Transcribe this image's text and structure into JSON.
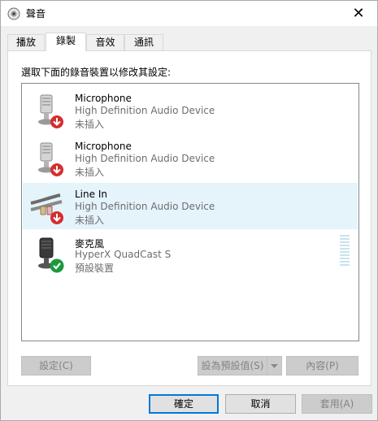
{
  "window": {
    "title": "聲音",
    "close_glyph": "✕"
  },
  "tabs": [
    {
      "label": "播放",
      "active": false
    },
    {
      "label": "錄製",
      "active": true
    },
    {
      "label": "音效",
      "active": false
    },
    {
      "label": "通訊",
      "active": false
    }
  ],
  "panel": {
    "instruction": "選取下面的錄音裝置以修改其設定:"
  },
  "devices": [
    {
      "name": "Microphone",
      "description": "High Definition Audio Device",
      "status": "未插入",
      "icon": "microphone-icon",
      "badge": "unplugged-arrow-icon",
      "selected": false
    },
    {
      "name": "Microphone",
      "description": "High Definition Audio Device",
      "status": "未插入",
      "icon": "microphone-icon",
      "badge": "unplugged-arrow-icon",
      "selected": false
    },
    {
      "name": "Line In",
      "description": "High Definition Audio Device",
      "status": "未插入",
      "icon": "line-in-cable-icon",
      "badge": "unplugged-arrow-icon",
      "selected": true
    },
    {
      "name": "麥克風",
      "description": "HyperX QuadCast S",
      "status": "預設裝置",
      "icon": "microphone-icon",
      "badge": "default-check-icon",
      "selected": false
    }
  ],
  "panel_buttons": {
    "configure": "設定(C)",
    "set_default": "設為預設值(S)",
    "properties": "內容(P)"
  },
  "dialog_buttons": {
    "ok": "確定",
    "cancel": "取消",
    "apply": "套用(A)"
  },
  "colors": {
    "selected_row": "#e5f3fb",
    "focus_border": "#0078d7",
    "unplugged_badge": "#d32f2f",
    "default_badge": "#1a9a3c"
  }
}
